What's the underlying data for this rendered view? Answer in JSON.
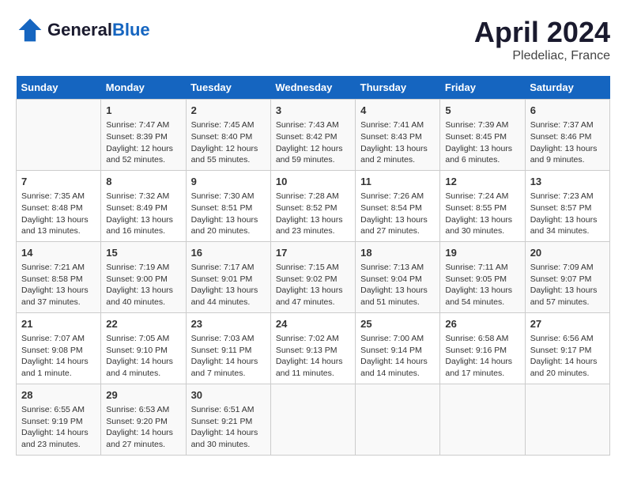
{
  "header": {
    "logo_general": "General",
    "logo_blue": "Blue",
    "title": "April 2024",
    "subtitle": "Pledeliac, France"
  },
  "days_of_week": [
    "Sunday",
    "Monday",
    "Tuesday",
    "Wednesday",
    "Thursday",
    "Friday",
    "Saturday"
  ],
  "weeks": [
    [
      {
        "num": "",
        "lines": []
      },
      {
        "num": "1",
        "lines": [
          "Sunrise: 7:47 AM",
          "Sunset: 8:39 PM",
          "Daylight: 12 hours",
          "and 52 minutes."
        ]
      },
      {
        "num": "2",
        "lines": [
          "Sunrise: 7:45 AM",
          "Sunset: 8:40 PM",
          "Daylight: 12 hours",
          "and 55 minutes."
        ]
      },
      {
        "num": "3",
        "lines": [
          "Sunrise: 7:43 AM",
          "Sunset: 8:42 PM",
          "Daylight: 12 hours",
          "and 59 minutes."
        ]
      },
      {
        "num": "4",
        "lines": [
          "Sunrise: 7:41 AM",
          "Sunset: 8:43 PM",
          "Daylight: 13 hours",
          "and 2 minutes."
        ]
      },
      {
        "num": "5",
        "lines": [
          "Sunrise: 7:39 AM",
          "Sunset: 8:45 PM",
          "Daylight: 13 hours",
          "and 6 minutes."
        ]
      },
      {
        "num": "6",
        "lines": [
          "Sunrise: 7:37 AM",
          "Sunset: 8:46 PM",
          "Daylight: 13 hours",
          "and 9 minutes."
        ]
      }
    ],
    [
      {
        "num": "7",
        "lines": [
          "Sunrise: 7:35 AM",
          "Sunset: 8:48 PM",
          "Daylight: 13 hours",
          "and 13 minutes."
        ]
      },
      {
        "num": "8",
        "lines": [
          "Sunrise: 7:32 AM",
          "Sunset: 8:49 PM",
          "Daylight: 13 hours",
          "and 16 minutes."
        ]
      },
      {
        "num": "9",
        "lines": [
          "Sunrise: 7:30 AM",
          "Sunset: 8:51 PM",
          "Daylight: 13 hours",
          "and 20 minutes."
        ]
      },
      {
        "num": "10",
        "lines": [
          "Sunrise: 7:28 AM",
          "Sunset: 8:52 PM",
          "Daylight: 13 hours",
          "and 23 minutes."
        ]
      },
      {
        "num": "11",
        "lines": [
          "Sunrise: 7:26 AM",
          "Sunset: 8:54 PM",
          "Daylight: 13 hours",
          "and 27 minutes."
        ]
      },
      {
        "num": "12",
        "lines": [
          "Sunrise: 7:24 AM",
          "Sunset: 8:55 PM",
          "Daylight: 13 hours",
          "and 30 minutes."
        ]
      },
      {
        "num": "13",
        "lines": [
          "Sunrise: 7:23 AM",
          "Sunset: 8:57 PM",
          "Daylight: 13 hours",
          "and 34 minutes."
        ]
      }
    ],
    [
      {
        "num": "14",
        "lines": [
          "Sunrise: 7:21 AM",
          "Sunset: 8:58 PM",
          "Daylight: 13 hours",
          "and 37 minutes."
        ]
      },
      {
        "num": "15",
        "lines": [
          "Sunrise: 7:19 AM",
          "Sunset: 9:00 PM",
          "Daylight: 13 hours",
          "and 40 minutes."
        ]
      },
      {
        "num": "16",
        "lines": [
          "Sunrise: 7:17 AM",
          "Sunset: 9:01 PM",
          "Daylight: 13 hours",
          "and 44 minutes."
        ]
      },
      {
        "num": "17",
        "lines": [
          "Sunrise: 7:15 AM",
          "Sunset: 9:02 PM",
          "Daylight: 13 hours",
          "and 47 minutes."
        ]
      },
      {
        "num": "18",
        "lines": [
          "Sunrise: 7:13 AM",
          "Sunset: 9:04 PM",
          "Daylight: 13 hours",
          "and 51 minutes."
        ]
      },
      {
        "num": "19",
        "lines": [
          "Sunrise: 7:11 AM",
          "Sunset: 9:05 PM",
          "Daylight: 13 hours",
          "and 54 minutes."
        ]
      },
      {
        "num": "20",
        "lines": [
          "Sunrise: 7:09 AM",
          "Sunset: 9:07 PM",
          "Daylight: 13 hours",
          "and 57 minutes."
        ]
      }
    ],
    [
      {
        "num": "21",
        "lines": [
          "Sunrise: 7:07 AM",
          "Sunset: 9:08 PM",
          "Daylight: 14 hours",
          "and 1 minute."
        ]
      },
      {
        "num": "22",
        "lines": [
          "Sunrise: 7:05 AM",
          "Sunset: 9:10 PM",
          "Daylight: 14 hours",
          "and 4 minutes."
        ]
      },
      {
        "num": "23",
        "lines": [
          "Sunrise: 7:03 AM",
          "Sunset: 9:11 PM",
          "Daylight: 14 hours",
          "and 7 minutes."
        ]
      },
      {
        "num": "24",
        "lines": [
          "Sunrise: 7:02 AM",
          "Sunset: 9:13 PM",
          "Daylight: 14 hours",
          "and 11 minutes."
        ]
      },
      {
        "num": "25",
        "lines": [
          "Sunrise: 7:00 AM",
          "Sunset: 9:14 PM",
          "Daylight: 14 hours",
          "and 14 minutes."
        ]
      },
      {
        "num": "26",
        "lines": [
          "Sunrise: 6:58 AM",
          "Sunset: 9:16 PM",
          "Daylight: 14 hours",
          "and 17 minutes."
        ]
      },
      {
        "num": "27",
        "lines": [
          "Sunrise: 6:56 AM",
          "Sunset: 9:17 PM",
          "Daylight: 14 hours",
          "and 20 minutes."
        ]
      }
    ],
    [
      {
        "num": "28",
        "lines": [
          "Sunrise: 6:55 AM",
          "Sunset: 9:19 PM",
          "Daylight: 14 hours",
          "and 23 minutes."
        ]
      },
      {
        "num": "29",
        "lines": [
          "Sunrise: 6:53 AM",
          "Sunset: 9:20 PM",
          "Daylight: 14 hours",
          "and 27 minutes."
        ]
      },
      {
        "num": "30",
        "lines": [
          "Sunrise: 6:51 AM",
          "Sunset: 9:21 PM",
          "Daylight: 14 hours",
          "and 30 minutes."
        ]
      },
      {
        "num": "",
        "lines": []
      },
      {
        "num": "",
        "lines": []
      },
      {
        "num": "",
        "lines": []
      },
      {
        "num": "",
        "lines": []
      }
    ]
  ]
}
